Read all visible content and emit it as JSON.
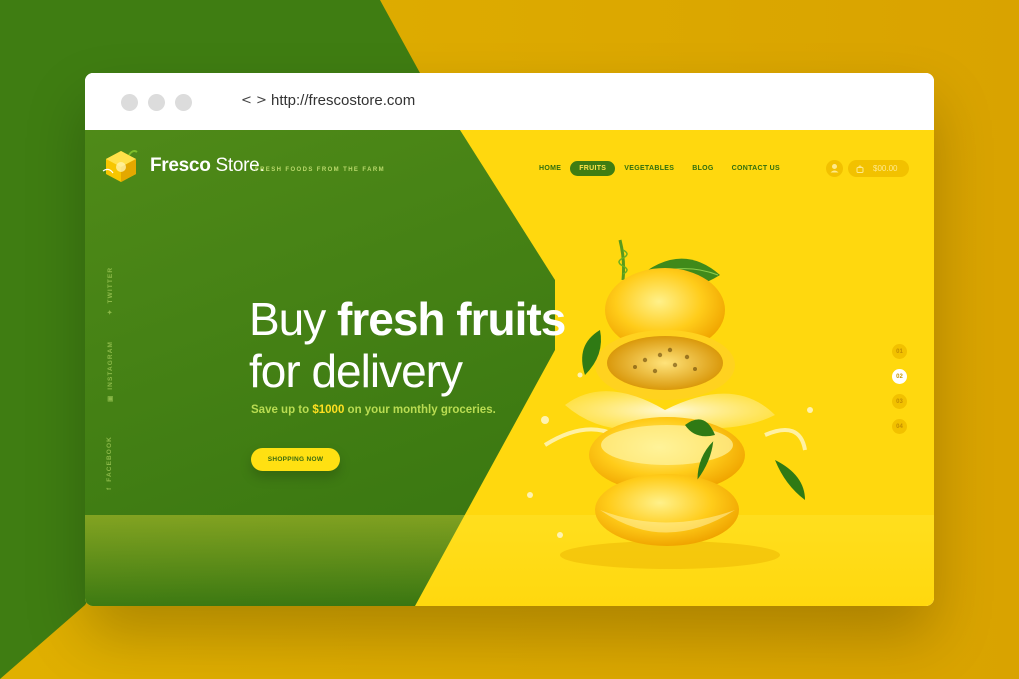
{
  "browser": {
    "nav_arrows": "< >",
    "url": "http://frescostore.com"
  },
  "header": {
    "logo_bold": "Fresco",
    "logo_light": " Store.",
    "tagline": "FRESH FOODS FROM THE FARM",
    "nav": [
      {
        "label": "HOME",
        "active": false
      },
      {
        "label": "FRUITS",
        "active": true
      },
      {
        "label": "VEGETABLES",
        "active": false
      },
      {
        "label": "BLOG",
        "active": false
      },
      {
        "label": "CONTACT US",
        "active": false
      }
    ],
    "cart_amount": "$00.00"
  },
  "socials": [
    {
      "label": "TWITTER",
      "icon": "twitter-icon"
    },
    {
      "label": "INSTAGRAM",
      "icon": "instagram-icon"
    },
    {
      "label": "FACEBOOK",
      "icon": "facebook-icon"
    }
  ],
  "hero": {
    "line1_light": "Buy ",
    "line1_bold": "fresh fruits",
    "line2": "for delivery",
    "sub_before": "Save up to ",
    "sub_highlight": "$1000",
    "sub_after": " on your monthly groceries.",
    "cta": "SHOPPING NOW"
  },
  "pager": [
    {
      "label": "01",
      "active": false
    },
    {
      "label": "02",
      "active": true
    },
    {
      "label": "03",
      "active": false
    },
    {
      "label": "04",
      "active": false
    }
  ],
  "colors": {
    "green": "#3f7d12",
    "yellow": "#ffd80e",
    "accent_yellow": "#ffe012",
    "light_green_text": "#b9dc52"
  }
}
